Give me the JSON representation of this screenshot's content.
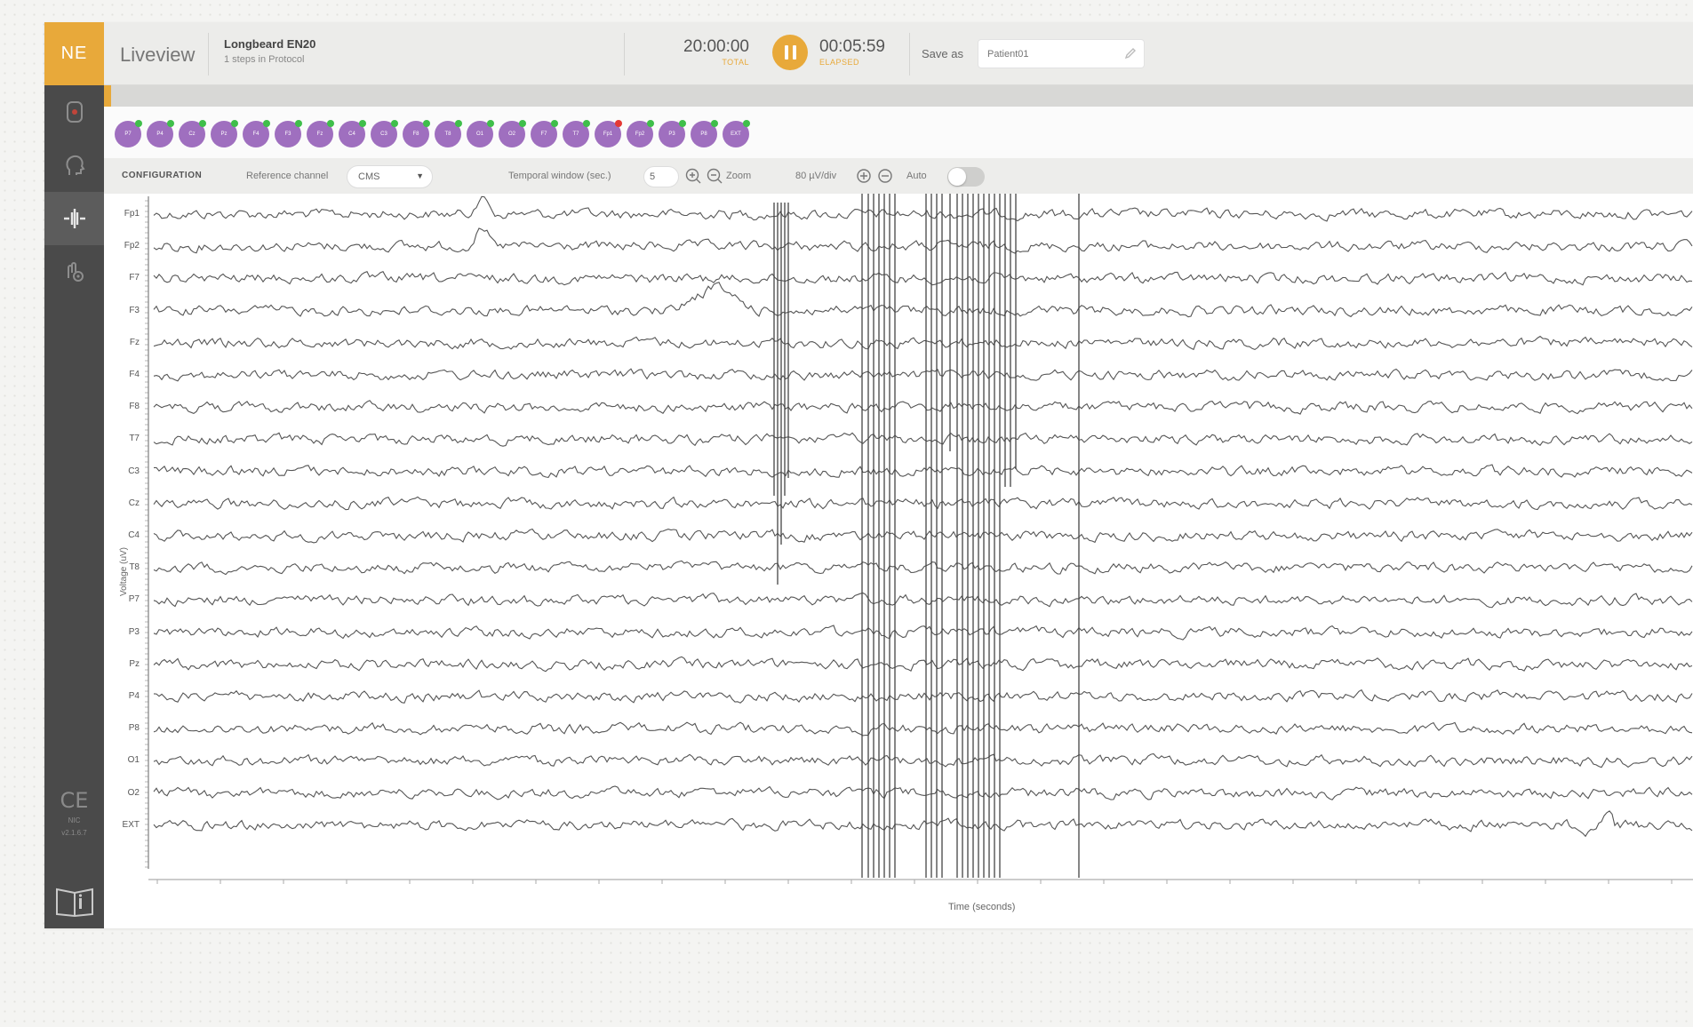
{
  "sidebar": {
    "logo": "NE",
    "ce_mark": "CE",
    "ce_text": [
      "NIC",
      "v2.1.6.7"
    ]
  },
  "header": {
    "title": "Liveview",
    "protocol_name": "Longbeard EN20",
    "protocol_steps": "1 steps in Protocol",
    "total_time": "20:00:00",
    "total_label": "TOTAL",
    "elapsed_time": "00:05:59",
    "elapsed_label": "ELAPSED",
    "save_as_label": "Save as",
    "save_as_placeholder": "Patient01"
  },
  "electrodes": [
    {
      "label": "P7",
      "status": "ok"
    },
    {
      "label": "P4",
      "status": "ok"
    },
    {
      "label": "Cz",
      "status": "ok"
    },
    {
      "label": "Pz",
      "status": "ok"
    },
    {
      "label": "F4",
      "status": "ok"
    },
    {
      "label": "F3",
      "status": "ok"
    },
    {
      "label": "Fz",
      "status": "ok"
    },
    {
      "label": "C4",
      "status": "ok"
    },
    {
      "label": "C3",
      "status": "ok"
    },
    {
      "label": "F8",
      "status": "ok"
    },
    {
      "label": "T8",
      "status": "ok"
    },
    {
      "label": "O1",
      "status": "ok"
    },
    {
      "label": "O2",
      "status": "ok"
    },
    {
      "label": "F7",
      "status": "ok"
    },
    {
      "label": "T7",
      "status": "ok"
    },
    {
      "label": "Fp1",
      "status": "bad"
    },
    {
      "label": "Fp2",
      "status": "ok"
    },
    {
      "label": "P3",
      "status": "ok"
    },
    {
      "label": "P8",
      "status": "ok"
    },
    {
      "label": "EXT",
      "status": "ok"
    }
  ],
  "config": {
    "title": "CONFIGURATION",
    "reference_label": "Reference channel",
    "reference_value": "CMS",
    "temporal_label": "Temporal window (sec.)",
    "temporal_value": "5",
    "zoom_label": "Zoom",
    "scale_label": "80 µV/div",
    "auto_label": "Auto",
    "auto_on": false
  },
  "plot": {
    "ylabel": "Voltage (uV)",
    "xlabel": "Time (seconds)",
    "channels": [
      "Fp1",
      "Fp2",
      "F7",
      "F3",
      "Fz",
      "F4",
      "F8",
      "T7",
      "C3",
      "Cz",
      "C4",
      "T8",
      "P7",
      "P3",
      "Pz",
      "P4",
      "P8",
      "O1",
      "O2",
      "EXT"
    ]
  },
  "colors": {
    "accent": "#e8a93a",
    "sidebar": "#4a4a4a",
    "electrode": "#9f6fbf",
    "electrode_ok": "#3fbf4a",
    "electrode_bad": "#e53935",
    "trace": "#555555"
  }
}
